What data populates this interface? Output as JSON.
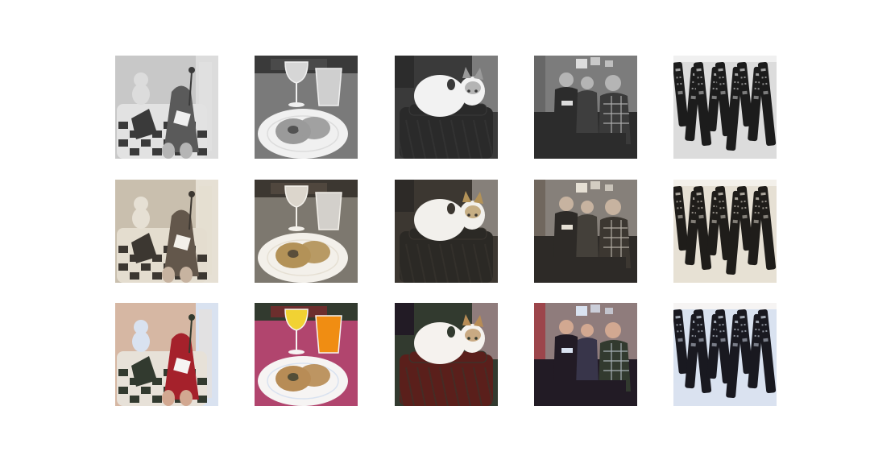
{
  "figure": {
    "rows": [
      {
        "variant": "grayscale"
      },
      {
        "variant": "sepia-desaturated"
      },
      {
        "variant": "color"
      }
    ],
    "columns": [
      {
        "subject": "sofa-with-teddy-bear"
      },
      {
        "subject": "donut-plate-with-drinks"
      },
      {
        "subject": "cat-on-suitcase"
      },
      {
        "subject": "people-on-couch"
      },
      {
        "subject": "remote-controls"
      }
    ],
    "palettes": {
      "grayscale": {
        "wall": "#c8c8c8",
        "sofa": "#e2e2e2",
        "check": "#3a3a3a",
        "cloth": "#5a5a5a",
        "table": "#7a7a7a",
        "plate": "#f0f0f0",
        "donut": "#9a9a9a",
        "drinkA": "#d6d6d6",
        "drinkB": "#cfcfcf",
        "bag": "#2a2a2a",
        "cat": "#f2f2f2",
        "room": "#7c7c7c",
        "couch": "#2c2c2c",
        "shirt": "#3e3e3e",
        "skin": "#b5b5b5",
        "remote": "#1c1c1c",
        "light": "#dcdcdc"
      },
      "sepia-desaturated": {
        "wall": "#c9bfae",
        "sofa": "#e4ddcf",
        "check": "#3c3731",
        "cloth": "#63574b",
        "table": "#7d786f",
        "plate": "#f3f0ea",
        "donut": "#b39258",
        "drinkA": "#dcd6cc",
        "drinkB": "#d3d0cb",
        "bag": "#2b2925",
        "cat": "#f2f0ec",
        "room": "#86807a",
        "couch": "#2d2a27",
        "shirt": "#44403a",
        "skin": "#c7b3a0",
        "remote": "#1f1d1a",
        "light": "#e6e0d4"
      },
      "color": {
        "wall": "#d6b7a3",
        "sofa": "#e7e1d8",
        "check": "#323a2f",
        "cloth": "#a5212b",
        "table": "#b1456e",
        "plate": "#f6f4f3",
        "donut": "#b78c56",
        "drinkA": "#f1d233",
        "drinkB": "#f08d12",
        "bag": "#5a1f1b",
        "cat": "#f5f2ee",
        "room": "#8f7c7c",
        "couch": "#221b25",
        "shirt": "#38354a",
        "skin": "#d2a891",
        "remote": "#191920",
        "light": "#d9e2f0"
      }
    }
  }
}
